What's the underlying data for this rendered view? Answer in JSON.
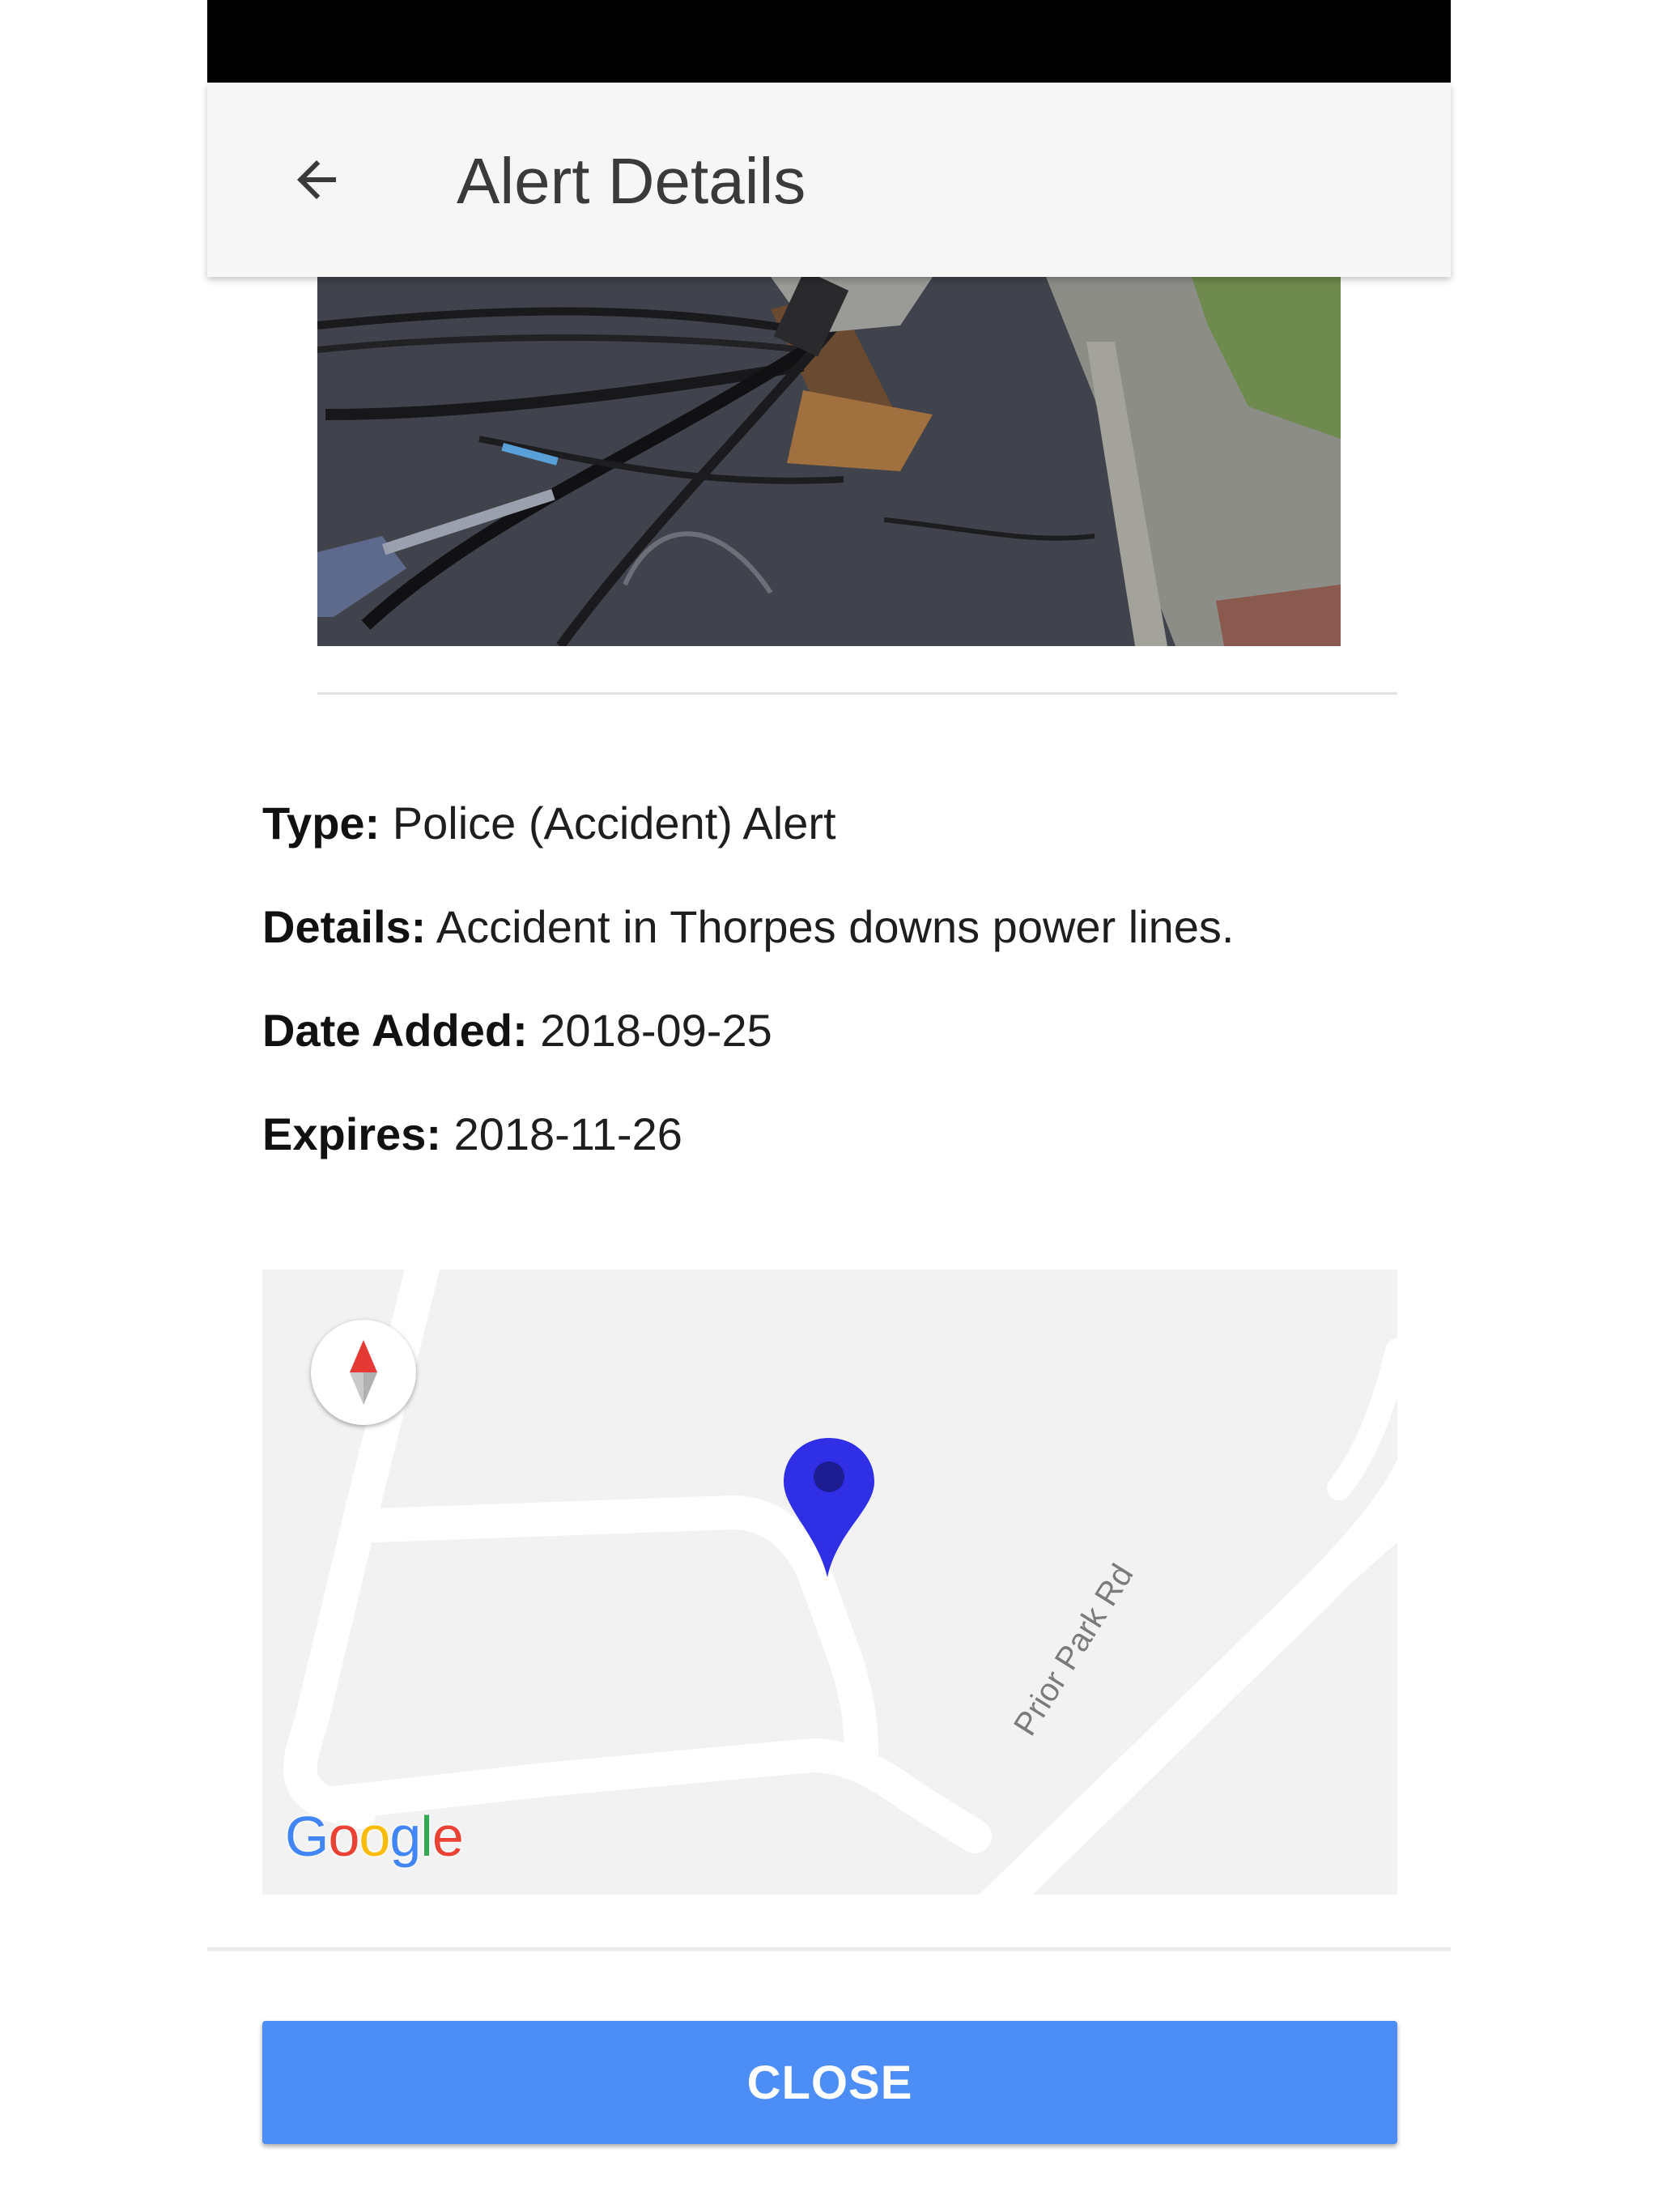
{
  "app_bar": {
    "back_icon": "arrow-left-icon",
    "title": "Alert Details"
  },
  "alert": {
    "photo_subject": "downed utility pole and power lines on road",
    "type_label": "Type:",
    "type_value": "Police (Accident) Alert",
    "details_label": "Details:",
    "details_value": "Accident in Thorpes downs power lines.",
    "date_added_label": "Date Added:",
    "date_added_value": "2018-09-25",
    "expires_label": "Expires:",
    "expires_value": "2018-11-26"
  },
  "map": {
    "compass_icon": "compass-icon",
    "marker_icon": "map-marker-icon",
    "marker_color": "#2f2fe6",
    "street_label": "Prior Park Rd",
    "logo_letters": [
      "G",
      "o",
      "o",
      "g",
      "l",
      "e"
    ],
    "logo_colors": [
      "#4285F4",
      "#EA4335",
      "#FBBC05",
      "#4285F4",
      "#34A853",
      "#EA4335"
    ]
  },
  "footer": {
    "close_label": "CLOSE",
    "button_color": "#4c8df6"
  }
}
